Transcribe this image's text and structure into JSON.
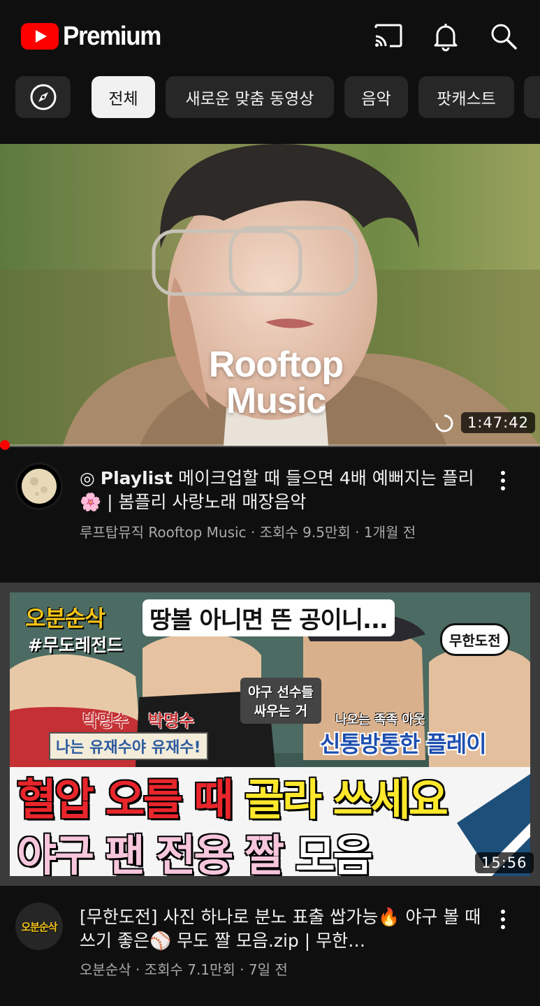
{
  "header": {
    "brand": "Premium",
    "icons": [
      "cast-icon",
      "notifications-icon",
      "search-icon"
    ]
  },
  "chips": [
    "전체",
    "새로운 맞춤 동영상",
    "음악",
    "팟캐스트"
  ],
  "videos": [
    {
      "thumb_text_1": "Rooftop",
      "thumb_text_2": "Music",
      "duration": "1:47:42",
      "title_mark": "◎",
      "title_bold": "Playlist",
      "title_rest": "메이크업할 때 들으면 4배 예뻐지는 플리🌸 | 봄플리 사랑노래 매장음악",
      "meta": "루프탑뮤직 Rooftop Music · 조회수 9.5만회 · 1개월 전"
    },
    {
      "thumb_logo": "오분순삭",
      "thumb_tag": "#무도레전드",
      "thumb_caption": "땅볼 아니면 뜬 공이니...",
      "thumb_badge": "무한도전",
      "thumb_name_1": "박명수",
      "thumb_name_2": "박명수",
      "thumb_sub_1": "나는 유재수야 유재수!",
      "thumb_bubble": "야구 선수들 싸우는 거",
      "thumb_small": "나오는 족족 아웃",
      "thumb_play": "신통방통한 플레이",
      "thumb_line1_red": "혈압 오를 때",
      "thumb_line1_yellow": "골라 쓰세요",
      "thumb_line2_pink": "야구 팬 전용 짤",
      "thumb_line2_white": "모음",
      "duration": "15:56",
      "avatar_text": "오분순삭",
      "title": "[무한도전] 사진 하나로 분노 표출 쌉가능🔥 야구 볼 때 쓰기 좋은⚾ 무도 짤 모음.zip | 무한…",
      "meta": "오분순삭 · 조회수 7.1만회 · 7일 전"
    }
  ],
  "colors": {
    "background": "#0f0f0f",
    "chip": "#272727",
    "chip_active": "#f1f1f1",
    "accent": "#ff0000",
    "secondary_text": "#aaaaaa"
  }
}
